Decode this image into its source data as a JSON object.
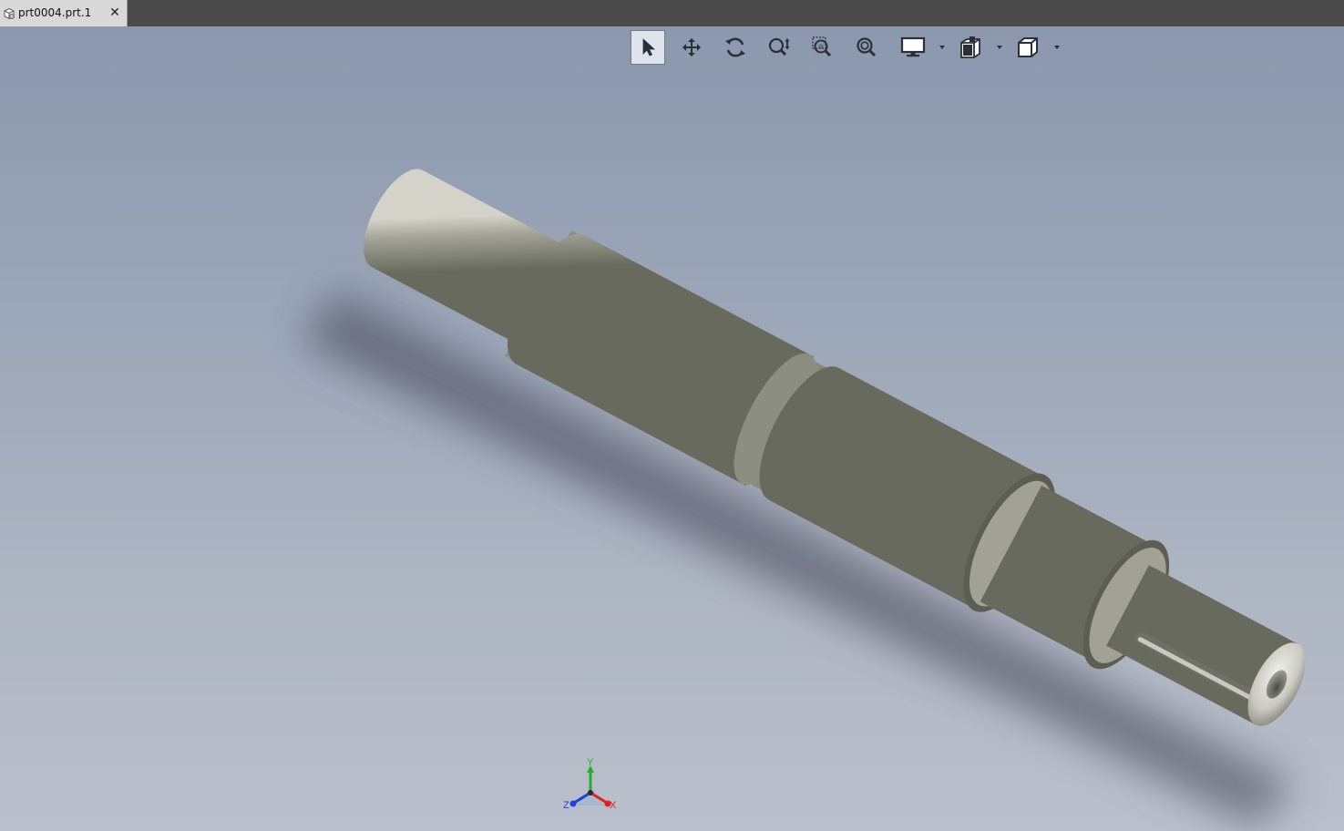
{
  "tab": {
    "title": "prt0004.prt.1",
    "close_symbol": "✕",
    "icon": "part-document-icon"
  },
  "toolbar": {
    "tools": [
      {
        "name": "select-tool",
        "icon": "arrow-cursor-icon",
        "active": true
      },
      {
        "name": "pan-tool",
        "icon": "four-way-arrow-icon",
        "active": false
      },
      {
        "name": "rotate-tool",
        "icon": "rotate-arrows-icon",
        "active": false
      },
      {
        "name": "zoom-tool",
        "icon": "zoom-updown-icon",
        "active": false
      },
      {
        "name": "zoom-window-tool",
        "icon": "zoom-window-icon",
        "active": false
      },
      {
        "name": "zoom-fit-tool",
        "icon": "zoom-fit-icon",
        "active": false
      },
      {
        "name": "display-style-tool",
        "icon": "monitor-icon",
        "active": false
      },
      {
        "name": "view-tool",
        "icon": "views-stack-icon",
        "active": false
      },
      {
        "name": "view-cube-tool",
        "icon": "cube-icon",
        "active": false
      }
    ]
  },
  "triad": {
    "y_label": "Y",
    "z_label": "Z",
    "x_label": "X",
    "x_color": "#e02020",
    "y_color": "#20b030",
    "z_color": "#2040e0"
  },
  "model": {
    "name": "stepped-shaft",
    "color": "#9a9b8e",
    "background_top": "#8b98ad",
    "background_bottom": "#bac0cb"
  }
}
